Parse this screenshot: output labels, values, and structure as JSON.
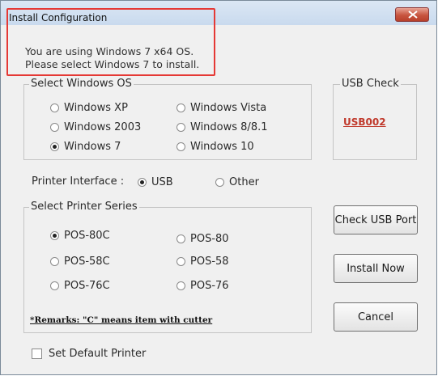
{
  "window": {
    "title": "Install Configuration",
    "close_label": "close"
  },
  "info": {
    "line1": "You are using Windows 7 x64 OS.",
    "line2": "Please select Windows 7 to install."
  },
  "os_group": {
    "title": "Select Windows OS",
    "options": [
      {
        "label": "Windows XP",
        "checked": false
      },
      {
        "label": "Windows Vista",
        "checked": false
      },
      {
        "label": "Windows 2003",
        "checked": false
      },
      {
        "label": "Windows 8/8.1",
        "checked": false
      },
      {
        "label": "Windows 7",
        "checked": true
      },
      {
        "label": "Windows 10",
        "checked": false
      }
    ]
  },
  "usb_check": {
    "title": "USB Check",
    "value": "USB002"
  },
  "printer_interface": {
    "label": "Printer Interface :",
    "options": [
      {
        "label": "USB",
        "checked": true
      },
      {
        "label": "Other",
        "checked": false
      }
    ]
  },
  "printer_series": {
    "title": "Select Printer Series",
    "options": [
      {
        "label": "POS-80C",
        "checked": true
      },
      {
        "label": "POS-80",
        "checked": false
      },
      {
        "label": "POS-58C",
        "checked": false
      },
      {
        "label": "POS-58",
        "checked": false
      },
      {
        "label": "POS-76C",
        "checked": false
      },
      {
        "label": "POS-76",
        "checked": false
      }
    ],
    "remark": "*Remarks: \"C\" means item with cutter"
  },
  "buttons": {
    "check_usb": "Check USB Port",
    "install": "Install Now",
    "cancel": "Cancel"
  },
  "default_printer": {
    "label": "Set Default Printer",
    "checked": false
  },
  "colors": {
    "highlight": "#e53935",
    "usb_value": "#c0392b"
  }
}
